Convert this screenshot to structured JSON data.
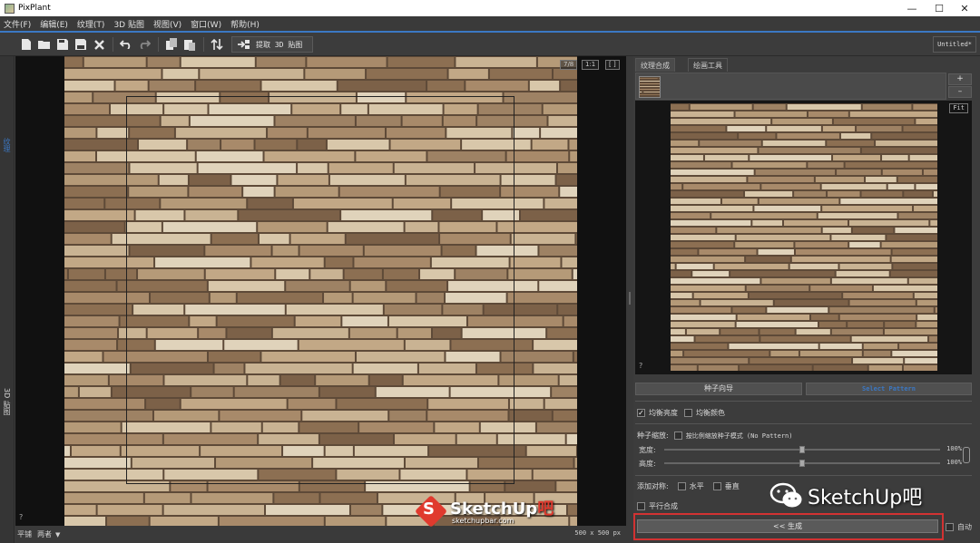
{
  "window": {
    "title": "PixPlant",
    "controls": [
      "—",
      "☐",
      "✕"
    ]
  },
  "menu": [
    "文件(F)",
    "编辑(E)",
    "纹理(T)",
    "3D 贴图",
    "视图(V)",
    "窗口(W)",
    "帮助(H)"
  ],
  "toolbar": {
    "buttons": [
      "new-icon",
      "open-icon",
      "save-icon",
      "save-as-icon",
      "close-icon",
      "undo-icon",
      "redo-icon",
      "copy-icon",
      "paste-icon",
      "flip-icon"
    ],
    "extract_label": "提取 3D 贴图",
    "document_name": "Untitled*"
  },
  "side_tabs": {
    "texture": "纹理",
    "map3d": "3D 贴图"
  },
  "canvas": {
    "zoom_controls": [
      "7/8",
      "1:1",
      "[ ]"
    ],
    "help": "?"
  },
  "bottom_bar": {
    "mode_label": "平铺",
    "mode_value": "两者",
    "size_readout": "500 x 500 px"
  },
  "right_panel": {
    "tabs": [
      "纹理合成",
      "绘画工具"
    ],
    "add": "+",
    "remove": "–",
    "fit": "Fit",
    "help": "?",
    "seed_wizard": "种子向导",
    "seed_pattern_action": "Select Pattern",
    "balance_brightness": {
      "label": "均衡亮度",
      "checked": true
    },
    "balance_color": {
      "label": "均衡颜色",
      "checked": false
    },
    "seed_scale_label": "种子缩放:",
    "proportional_mode": {
      "label": "按比例缩放种子模式 (No Pattern)",
      "checked": false
    },
    "width": {
      "label": "宽度:",
      "value": "100%",
      "level": 0.5
    },
    "height": {
      "label": "高度:",
      "value": "100%",
      "level": 0.5
    },
    "add_symmetry_label": "添加对称:",
    "horizontal": {
      "label": "水平",
      "checked": false
    },
    "vertical": {
      "label": "垂直",
      "checked": false
    },
    "parallel": {
      "label": "平行合成",
      "checked": false
    },
    "generate": "<< 生成",
    "auto": {
      "label": "自动",
      "checked": false
    }
  },
  "watermarks": {
    "logo_brand": "SketchUp",
    "logo_suffix": "吧",
    "logo_url": "sketchupbar.com",
    "wechat_text": "SketchUp吧"
  },
  "colors": {
    "accent": "#3b78c4",
    "highlight_frame": "#d23232"
  }
}
